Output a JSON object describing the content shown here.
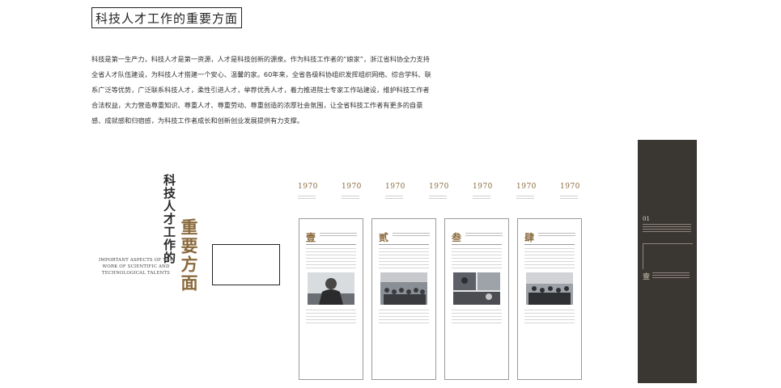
{
  "header": {
    "title": "科技人才工作的重要方面"
  },
  "intro": {
    "paragraph": "科技是第一生产力，科技人才是第一资源，人才是科技创新的源泉。作为科技工作者的“娘家”，浙江省科协全力支持全省人才队伍建设，为科技人才搭建一个安心、温馨的家。60年来，全省各级科协组织发挥组织网络、综合学科、联系广泛等优势，广泛联系科技人才，柔性引进人才，举荐优秀人才，着力推进院士专家工作站建设，维护科技工作者合法权益，大力营造尊重知识、尊重人才、尊重劳动、尊重创造的浓厚社会氛围，让全省科技工作者有更多的自豪感、成就感和归宿感，为科技工作者成长和创新创业发展提供有力支撑。"
  },
  "feature": {
    "vertical_title": "科技人才工作的",
    "vertical_main": "重要方面",
    "english_subtitle": "IMPORTANT ASPECTS OF THE WORK OF SCIENTIFIC AND TECHNOLOGICAL TALENTS"
  },
  "timeline": {
    "years": [
      "1970",
      "1970",
      "1970",
      "1970",
      "1970",
      "1970",
      "1970"
    ]
  },
  "panels": [
    {
      "numeral": "壹"
    },
    {
      "numeral": "贰"
    },
    {
      "numeral": "叁"
    },
    {
      "numeral": "肆"
    }
  ],
  "dark_panel": {
    "number": "01",
    "numeral": "壹"
  },
  "colors": {
    "accent_gold": "#8a6a3d",
    "dark_panel": "#3a3632"
  }
}
